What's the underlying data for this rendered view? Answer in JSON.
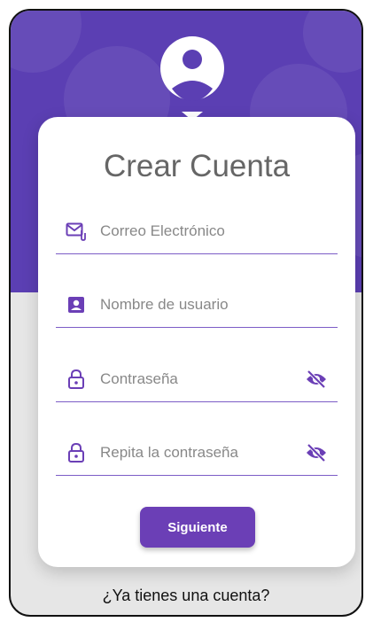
{
  "header": {
    "avatar_icon": "user-pin-icon",
    "accent": "#5b3fb3"
  },
  "form": {
    "title": "Crear Cuenta",
    "email": {
      "placeholder": "Correo Electrónico",
      "icon": "mail-attachment-icon"
    },
    "username": {
      "placeholder": "Nombre de usuario",
      "icon": "id-card-icon"
    },
    "password": {
      "placeholder": "Contraseña",
      "icon": "lock-icon",
      "toggle_icon": "eye-off-icon"
    },
    "repeat_password": {
      "placeholder": "Repita la contraseña",
      "icon": "lock-icon",
      "toggle_icon": "eye-off-icon"
    },
    "submit_label": "Siguiente",
    "button_color": "#6b3fb6"
  },
  "footer": {
    "login_link": "¿Ya tienes una cuenta?"
  }
}
